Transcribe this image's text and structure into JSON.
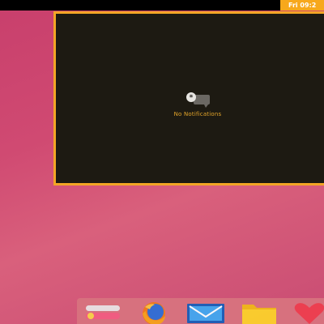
{
  "topbar": {
    "clock": "Fri 09:2"
  },
  "notifications": {
    "empty_label": "No Notifications",
    "icon": "notifications-empty-icon"
  },
  "dock": {
    "items": [
      {
        "name": "Settings",
        "icon": "settings-toggle-icon",
        "running": true
      },
      {
        "name": "Firefox",
        "icon": "firefox-icon",
        "running": false
      },
      {
        "name": "Mail",
        "icon": "mail-icon",
        "running": true
      },
      {
        "name": "Files",
        "icon": "folder-icon",
        "running": true
      },
      {
        "name": "Favorites",
        "icon": "heart-icon",
        "running": false
      }
    ]
  },
  "colors": {
    "accent": "#f7a81c",
    "panel_bg": "#1d1a12",
    "desktop": "#cf4a73"
  }
}
